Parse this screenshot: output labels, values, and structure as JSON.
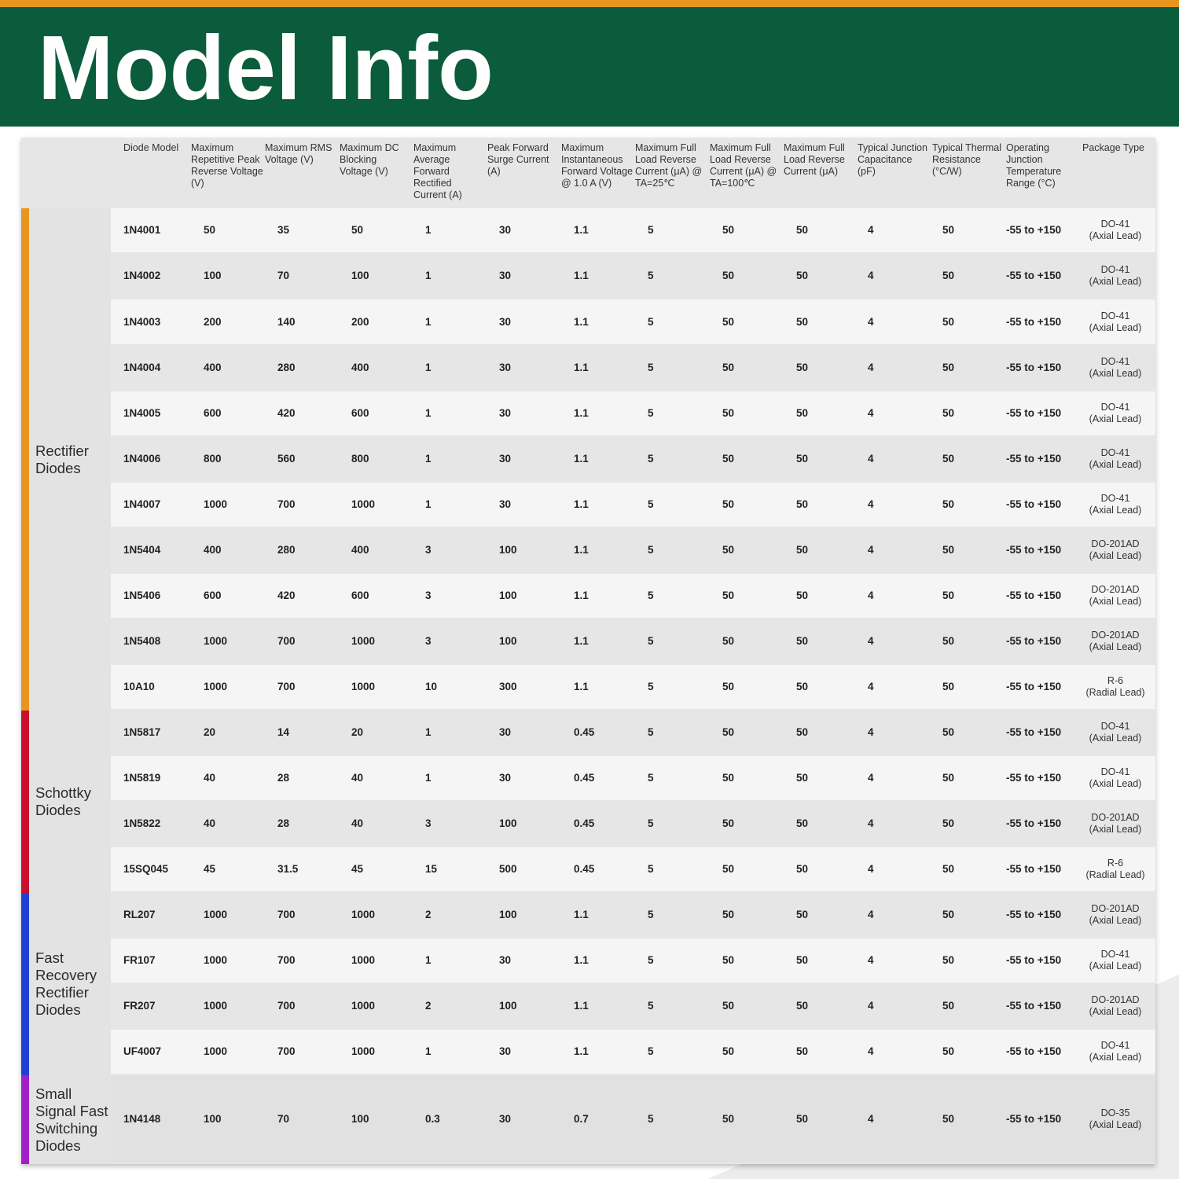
{
  "title": "Model Info",
  "columns": [
    "Diode Model",
    "Maximum Repetitive Peak Reverse Voltage (V)",
    "Maximum RMS Voltage (V)",
    "Maximum DC Blocking Voltage (V)",
    "Maximum Average Forward Rectified Current (A)",
    "Peak Forward Surge Current (A)",
    "Maximum Instantaneous Forward Voltage @ 1.0 A (V)",
    "Maximum Full Load Reverse Current (μA) @ TA=25℃",
    "Maximum Full Load Reverse Current (μA) @ TA=100℃",
    "Maximum Full Load Reverse Current (μA)",
    "Typical Junction Capacitance (pF)",
    "Typical Thermal Resistance (°C/W)",
    "Operating Junction Temperature Range (°C)",
    "Package Type"
  ],
  "categories": [
    {
      "label": "Rectifier Diodes",
      "color": "#e8951f"
    },
    {
      "label": "Schottky Diodes",
      "color": "#c8102e"
    },
    {
      "label": "Fast Recovery Rectifier Diodes",
      "color": "#1f3fd6"
    },
    {
      "label": "Small Signal Fast Switching Diodes",
      "color": "#a020c8"
    }
  ],
  "rows": [
    {
      "model": "1N4001",
      "vrrm": "50",
      "vrms": "35",
      "vdc": "50",
      "if": "1",
      "ifsm": "30",
      "vf": "1.1",
      "ir25": "5",
      "ir100": "50",
      "irfull": "50",
      "cj": "4",
      "rth": "50",
      "temp": "-55 to +150",
      "pkg": "DO-41",
      "lead": "(Axial Lead)"
    },
    {
      "model": "1N4002",
      "vrrm": "100",
      "vrms": "70",
      "vdc": "100",
      "if": "1",
      "ifsm": "30",
      "vf": "1.1",
      "ir25": "5",
      "ir100": "50",
      "irfull": "50",
      "cj": "4",
      "rth": "50",
      "temp": "-55 to +150",
      "pkg": "DO-41",
      "lead": "(Axial Lead)"
    },
    {
      "model": "1N4003",
      "vrrm": "200",
      "vrms": "140",
      "vdc": "200",
      "if": "1",
      "ifsm": "30",
      "vf": "1.1",
      "ir25": "5",
      "ir100": "50",
      "irfull": "50",
      "cj": "4",
      "rth": "50",
      "temp": "-55 to +150",
      "pkg": "DO-41",
      "lead": "(Axial Lead)"
    },
    {
      "model": "1N4004",
      "vrrm": "400",
      "vrms": "280",
      "vdc": "400",
      "if": "1",
      "ifsm": "30",
      "vf": "1.1",
      "ir25": "5",
      "ir100": "50",
      "irfull": "50",
      "cj": "4",
      "rth": "50",
      "temp": "-55 to +150",
      "pkg": "DO-41",
      "lead": "(Axial Lead)"
    },
    {
      "model": "1N4005",
      "vrrm": "600",
      "vrms": "420",
      "vdc": "600",
      "if": "1",
      "ifsm": "30",
      "vf": "1.1",
      "ir25": "5",
      "ir100": "50",
      "irfull": "50",
      "cj": "4",
      "rth": "50",
      "temp": "-55 to +150",
      "pkg": "DO-41",
      "lead": "(Axial Lead)"
    },
    {
      "model": "1N4006",
      "vrrm": "800",
      "vrms": "560",
      "vdc": "800",
      "if": "1",
      "ifsm": "30",
      "vf": "1.1",
      "ir25": "5",
      "ir100": "50",
      "irfull": "50",
      "cj": "4",
      "rth": "50",
      "temp": "-55 to +150",
      "pkg": "DO-41",
      "lead": "(Axial Lead)"
    },
    {
      "model": "1N4007",
      "vrrm": "1000",
      "vrms": "700",
      "vdc": "1000",
      "if": "1",
      "ifsm": "30",
      "vf": "1.1",
      "ir25": "5",
      "ir100": "50",
      "irfull": "50",
      "cj": "4",
      "rth": "50",
      "temp": "-55 to +150",
      "pkg": "DO-41",
      "lead": "(Axial Lead)"
    },
    {
      "model": "1N5404",
      "vrrm": "400",
      "vrms": "280",
      "vdc": "400",
      "if": "3",
      "ifsm": "100",
      "vf": "1.1",
      "ir25": "5",
      "ir100": "50",
      "irfull": "50",
      "cj": "4",
      "rth": "50",
      "temp": "-55 to +150",
      "pkg": "DO-201AD",
      "lead": "(Axial Lead)"
    },
    {
      "model": "1N5406",
      "vrrm": "600",
      "vrms": "420",
      "vdc": "600",
      "if": "3",
      "ifsm": "100",
      "vf": "1.1",
      "ir25": "5",
      "ir100": "50",
      "irfull": "50",
      "cj": "4",
      "rth": "50",
      "temp": "-55 to +150",
      "pkg": "DO-201AD",
      "lead": "(Axial Lead)"
    },
    {
      "model": "1N5408",
      "vrrm": "1000",
      "vrms": "700",
      "vdc": "1000",
      "if": "3",
      "ifsm": "100",
      "vf": "1.1",
      "ir25": "5",
      "ir100": "50",
      "irfull": "50",
      "cj": "4",
      "rth": "50",
      "temp": "-55 to +150",
      "pkg": "DO-201AD",
      "lead": "(Axial Lead)"
    },
    {
      "model": "10A10",
      "vrrm": "1000",
      "vrms": "700",
      "vdc": "1000",
      "if": "10",
      "ifsm": "300",
      "vf": "1.1",
      "ir25": "5",
      "ir100": "50",
      "irfull": "50",
      "cj": "4",
      "rth": "50",
      "temp": "-55 to +150",
      "pkg": "R-6",
      "lead": "(Radial Lead)"
    },
    {
      "model": "1N5817",
      "vrrm": "20",
      "vrms": "14",
      "vdc": "20",
      "if": "1",
      "ifsm": "30",
      "vf": "0.45",
      "ir25": "5",
      "ir100": "50",
      "irfull": "50",
      "cj": "4",
      "rth": "50",
      "temp": "-55 to +150",
      "pkg": "DO-41",
      "lead": "(Axial Lead)"
    },
    {
      "model": "1N5819",
      "vrrm": "40",
      "vrms": "28",
      "vdc": "40",
      "if": "1",
      "ifsm": "30",
      "vf": "0.45",
      "ir25": "5",
      "ir100": "50",
      "irfull": "50",
      "cj": "4",
      "rth": "50",
      "temp": "-55 to +150",
      "pkg": "DO-41",
      "lead": "(Axial Lead)"
    },
    {
      "model": "1N5822",
      "vrrm": "40",
      "vrms": "28",
      "vdc": "40",
      "if": "3",
      "ifsm": "100",
      "vf": "0.45",
      "ir25": "5",
      "ir100": "50",
      "irfull": "50",
      "cj": "4",
      "rth": "50",
      "temp": "-55 to +150",
      "pkg": "DO-201AD",
      "lead": "(Axial Lead)"
    },
    {
      "model": "15SQ045",
      "vrrm": "45",
      "vrms": "31.5",
      "vdc": "45",
      "if": "15",
      "ifsm": "500",
      "vf": "0.45",
      "ir25": "5",
      "ir100": "50",
      "irfull": "50",
      "cj": "4",
      "rth": "50",
      "temp": "-55 to +150",
      "pkg": "R-6",
      "lead": "(Radial Lead)"
    },
    {
      "model": "RL207",
      "vrrm": "1000",
      "vrms": "700",
      "vdc": "1000",
      "if": "2",
      "ifsm": "100",
      "vf": "1.1",
      "ir25": "5",
      "ir100": "50",
      "irfull": "50",
      "cj": "4",
      "rth": "50",
      "temp": "-55 to +150",
      "pkg": "DO-201AD",
      "lead": "(Axial Lead)"
    },
    {
      "model": "FR107",
      "vrrm": "1000",
      "vrms": "700",
      "vdc": "1000",
      "if": "1",
      "ifsm": "30",
      "vf": "1.1",
      "ir25": "5",
      "ir100": "50",
      "irfull": "50",
      "cj": "4",
      "rth": "50",
      "temp": "-55 to +150",
      "pkg": "DO-41",
      "lead": "(Axial Lead)"
    },
    {
      "model": "FR207",
      "vrrm": "1000",
      "vrms": "700",
      "vdc": "1000",
      "if": "2",
      "ifsm": "100",
      "vf": "1.1",
      "ir25": "5",
      "ir100": "50",
      "irfull": "50",
      "cj": "4",
      "rth": "50",
      "temp": "-55 to +150",
      "pkg": "DO-201AD",
      "lead": "(Axial Lead)"
    },
    {
      "model": "UF4007",
      "vrrm": "1000",
      "vrms": "700",
      "vdc": "1000",
      "if": "1",
      "ifsm": "30",
      "vf": "1.1",
      "ir25": "5",
      "ir100": "50",
      "irfull": "50",
      "cj": "4",
      "rth": "50",
      "temp": "-55 to +150",
      "pkg": "DO-41",
      "lead": "(Axial Lead)"
    },
    {
      "model": "1N4148",
      "vrrm": "100",
      "vrms": "70",
      "vdc": "100",
      "if": "0.3",
      "ifsm": "30",
      "vf": "0.7",
      "ir25": "5",
      "ir100": "50",
      "irfull": "50",
      "cj": "4",
      "rth": "50",
      "temp": "-55 to +150",
      "pkg": "DO-35",
      "lead": "(Axial Lead)"
    }
  ]
}
